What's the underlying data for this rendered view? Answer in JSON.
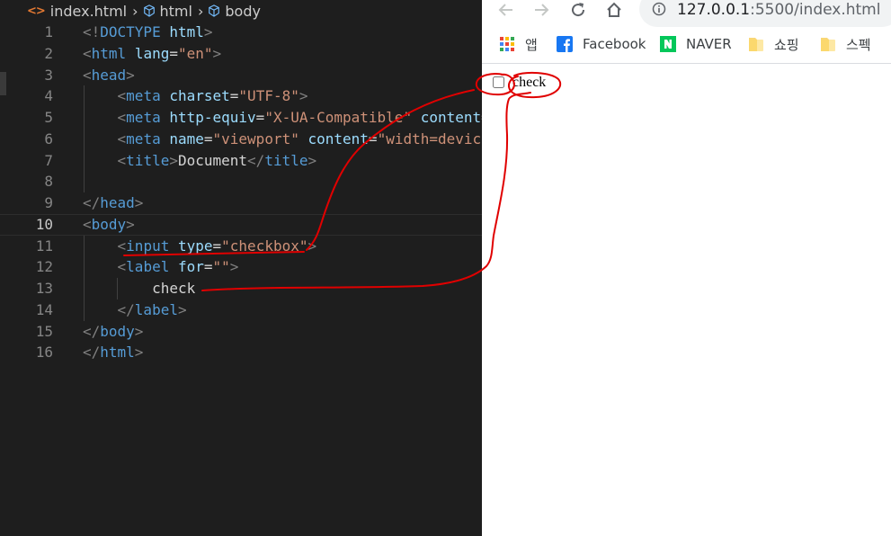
{
  "editor": {
    "breadcrumb": [
      {
        "label": "index.html",
        "icon": "html-file-icon"
      },
      {
        "label": "html",
        "icon": "cube-icon"
      },
      {
        "label": "body",
        "icon": "cube-icon"
      }
    ],
    "current_line": 10,
    "lines": [
      {
        "n": "1",
        "tokens": [
          [
            "br",
            "<!"
          ],
          [
            "tag",
            "DOCTYPE"
          ],
          [
            "txt",
            " "
          ],
          [
            "attr",
            "html"
          ],
          [
            "br",
            ">"
          ]
        ]
      },
      {
        "n": "2",
        "tokens": [
          [
            "br",
            "<"
          ],
          [
            "tag",
            "html"
          ],
          [
            "txt",
            " "
          ],
          [
            "attr",
            "lang"
          ],
          [
            "txt",
            "="
          ],
          [
            "str",
            "\"en\""
          ],
          [
            "br",
            ">"
          ]
        ]
      },
      {
        "n": "3",
        "tokens": [
          [
            "br",
            "<"
          ],
          [
            "tag",
            "head"
          ],
          [
            "br",
            ">"
          ]
        ]
      },
      {
        "n": "4",
        "tokens": [
          [
            "txt",
            "    "
          ],
          [
            "br",
            "<"
          ],
          [
            "tag",
            "meta"
          ],
          [
            "txt",
            " "
          ],
          [
            "attr",
            "charset"
          ],
          [
            "txt",
            "="
          ],
          [
            "str",
            "\"UTF-8\""
          ],
          [
            "br",
            ">"
          ]
        ]
      },
      {
        "n": "5",
        "tokens": [
          [
            "txt",
            "    "
          ],
          [
            "br",
            "<"
          ],
          [
            "tag",
            "meta"
          ],
          [
            "txt",
            " "
          ],
          [
            "attr",
            "http-equiv"
          ],
          [
            "txt",
            "="
          ],
          [
            "str",
            "\"X-UA-Compatible\""
          ],
          [
            "txt",
            " "
          ],
          [
            "attr",
            "content"
          ],
          [
            "txt",
            "="
          ]
        ]
      },
      {
        "n": "6",
        "tokens": [
          [
            "txt",
            "    "
          ],
          [
            "br",
            "<"
          ],
          [
            "tag",
            "meta"
          ],
          [
            "txt",
            " "
          ],
          [
            "attr",
            "name"
          ],
          [
            "txt",
            "="
          ],
          [
            "str",
            "\"viewport\""
          ],
          [
            "txt",
            " "
          ],
          [
            "attr",
            "content"
          ],
          [
            "txt",
            "="
          ],
          [
            "str",
            "\"width=devic"
          ]
        ]
      },
      {
        "n": "7",
        "tokens": [
          [
            "txt",
            "    "
          ],
          [
            "br",
            "<"
          ],
          [
            "tag",
            "title"
          ],
          [
            "br",
            ">"
          ],
          [
            "txt",
            "Document"
          ],
          [
            "br",
            "</"
          ],
          [
            "tag",
            "title"
          ],
          [
            "br",
            ">"
          ]
        ]
      },
      {
        "n": "8",
        "tokens": []
      },
      {
        "n": "9",
        "tokens": [
          [
            "br",
            "</"
          ],
          [
            "tag",
            "head"
          ],
          [
            "br",
            ">"
          ]
        ]
      },
      {
        "n": "10",
        "tokens": [
          [
            "br",
            "<"
          ],
          [
            "tag",
            "body"
          ],
          [
            "br",
            ">"
          ]
        ]
      },
      {
        "n": "11",
        "tokens": [
          [
            "txt",
            "    "
          ],
          [
            "br",
            "<"
          ],
          [
            "tag",
            "input"
          ],
          [
            "txt",
            " "
          ],
          [
            "attr",
            "type"
          ],
          [
            "txt",
            "="
          ],
          [
            "str",
            "\"checkbox\""
          ],
          [
            "br",
            ">"
          ]
        ]
      },
      {
        "n": "12",
        "tokens": [
          [
            "txt",
            "    "
          ],
          [
            "br",
            "<"
          ],
          [
            "tag",
            "label"
          ],
          [
            "txt",
            " "
          ],
          [
            "attr",
            "for"
          ],
          [
            "txt",
            "="
          ],
          [
            "str",
            "\"\""
          ],
          [
            "br",
            ">"
          ]
        ]
      },
      {
        "n": "13",
        "tokens": [
          [
            "txt",
            "        check"
          ]
        ]
      },
      {
        "n": "14",
        "tokens": [
          [
            "txt",
            "    "
          ],
          [
            "br",
            "</"
          ],
          [
            "tag",
            "label"
          ],
          [
            "br",
            ">"
          ]
        ]
      },
      {
        "n": "15",
        "tokens": [
          [
            "br",
            "</"
          ],
          [
            "tag",
            "body"
          ],
          [
            "br",
            ">"
          ]
        ]
      },
      {
        "n": "16",
        "tokens": [
          [
            "br",
            "</"
          ],
          [
            "tag",
            "html"
          ],
          [
            "br",
            ">"
          ]
        ]
      }
    ]
  },
  "browser": {
    "url_host": "127.0.0.1",
    "url_rest": ":5500/index.html",
    "bookmarks": [
      {
        "label": "앱",
        "icon": "apps-grid-icon"
      },
      {
        "label": "Facebook",
        "icon": "facebook-icon"
      },
      {
        "label": "NAVER",
        "icon": "naver-icon"
      },
      {
        "label": "쇼핑",
        "icon": "folder-icon"
      },
      {
        "label": "스펙",
        "icon": "folder-icon"
      }
    ],
    "page": {
      "checkbox_checked": false,
      "label": "check"
    }
  },
  "colors": {
    "editor_bg": "#1e1e1e",
    "tag": "#569cd6",
    "attr": "#9cdcfe",
    "string": "#ce9178",
    "bracket": "#808080",
    "annotation": "#e00000"
  }
}
